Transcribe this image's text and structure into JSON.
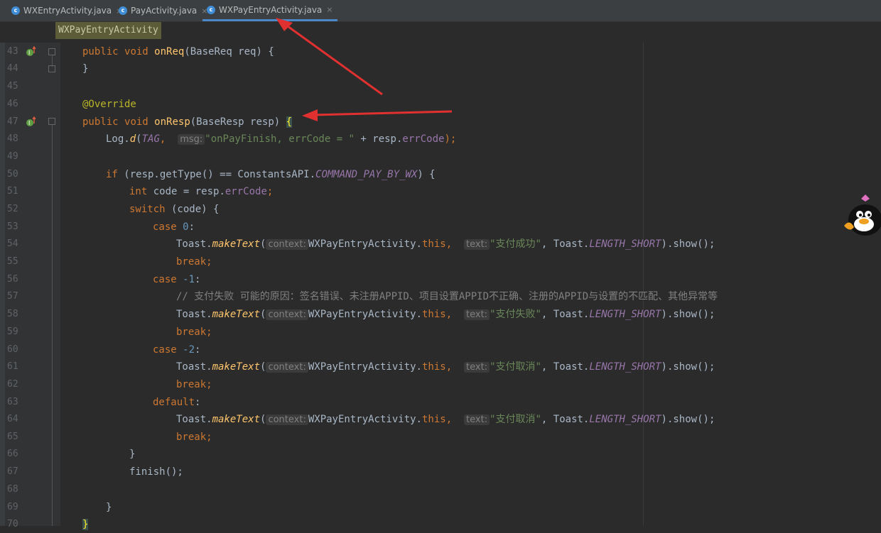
{
  "tabs": [
    {
      "label": "WXEntryActivity.java",
      "close": "×"
    },
    {
      "label": "PayActivity.java",
      "close": "×"
    },
    {
      "label": "WXPayEntryActivity.java",
      "close": "×"
    }
  ],
  "tab_icon_letter": "c",
  "breadcrumb": "WXPayEntryActivity",
  "line_numbers": [
    "43",
    "44",
    "45",
    "46",
    "47",
    "48",
    "49",
    "50",
    "51",
    "52",
    "53",
    "54",
    "55",
    "56",
    "57",
    "58",
    "59",
    "60",
    "61",
    "62",
    "63",
    "64",
    "65",
    "66",
    "67",
    "68",
    "69",
    "70"
  ],
  "code": {
    "l43": {
      "kw1": "public",
      "kw2": "void",
      "fn": "onReq",
      "rest": "(BaseReq req) {"
    },
    "l44": {
      "text": "}"
    },
    "l46": {
      "ann": "@Override"
    },
    "l47": {
      "kw1": "public",
      "kw2": "void",
      "fn": "onResp",
      "rest": "(BaseResp resp) ",
      "brace": "{"
    },
    "l48": {
      "a": "Log.",
      "fn": "d",
      "p1": "(",
      "tag": "TAG",
      "comma": ",",
      "hint": "msg:",
      "str": "\"onPayFinish, errCode = \"",
      "b": " + resp.",
      "field": "errCode",
      "c": ");"
    },
    "l50": {
      "kw": "if",
      "a": " (resp.getType() == ConstantsAPI.",
      "stat": "COMMAND_PAY_BY_WX",
      "b": ") {"
    },
    "l51": {
      "kw": "int",
      "a": " code = resp.",
      "field": "errCode",
      "b": ";"
    },
    "l52": {
      "kw": "switch",
      "a": " (code) {"
    },
    "l53": {
      "kw": "case",
      "num": "0",
      "b": ":"
    },
    "l54": {
      "a": "Toast.",
      "fn": "makeText",
      "p": "(",
      "hint1": "context:",
      "cls": "WXPayEntryActivity.",
      "kw": "this",
      "comma": ",",
      "hint2": "text:",
      "str": "\"支付成功\"",
      "mid": ", Toast.",
      "stat": "LENGTH_SHORT",
      "end": ").show();"
    },
    "l55": {
      "kw": "break",
      "b": ";"
    },
    "l56": {
      "kw": "case",
      "num": "-1",
      "b": ":"
    },
    "l57": {
      "cmt": "// 支付失败 可能的原因：签名错误、未注册APPID、项目设置APPID不正确、注册的APPID与设置的不匹配、其他异常等"
    },
    "l58": {
      "a": "Toast.",
      "fn": "makeText",
      "p": "(",
      "hint1": "context:",
      "cls": "WXPayEntryActivity.",
      "kw": "this",
      "comma": ",",
      "hint2": "text:",
      "str": "\"支付失败\"",
      "mid": ", Toast.",
      "stat": "LENGTH_SHORT",
      "end": ").show();"
    },
    "l59": {
      "kw": "break",
      "b": ";"
    },
    "l60": {
      "kw": "case",
      "num": "-2",
      "b": ":"
    },
    "l61": {
      "a": "Toast.",
      "fn": "makeText",
      "p": "(",
      "hint1": "context:",
      "cls": "WXPayEntryActivity.",
      "kw": "this",
      "comma": ",",
      "hint2": "text:",
      "str": "\"支付取消\"",
      "mid": ", Toast.",
      "stat": "LENGTH_SHORT",
      "end": ").show();"
    },
    "l62": {
      "kw": "break",
      "b": ";"
    },
    "l63": {
      "kw": "default",
      "b": ":"
    },
    "l64": {
      "a": "Toast.",
      "fn": "makeText",
      "p": "(",
      "hint1": "context:",
      "cls": "WXPayEntryActivity.",
      "kw": "this",
      "comma": ",",
      "hint2": "text:",
      "str": "\"支付取消\"",
      "mid": ", Toast.",
      "stat": "LENGTH_SHORT",
      "end": ").show();"
    },
    "l65": {
      "kw": "break",
      "b": ";"
    },
    "l66": {
      "text": "}"
    },
    "l67": {
      "text": "finish();"
    },
    "l69": {
      "text": "}"
    },
    "l70": {
      "text": "}"
    }
  },
  "colors": {
    "background": "#2b2b2b",
    "keyword": "#cc7832",
    "function": "#ffc66d",
    "string": "#6a8759",
    "annotation": "#bbb529",
    "arrow": "#e03030"
  }
}
